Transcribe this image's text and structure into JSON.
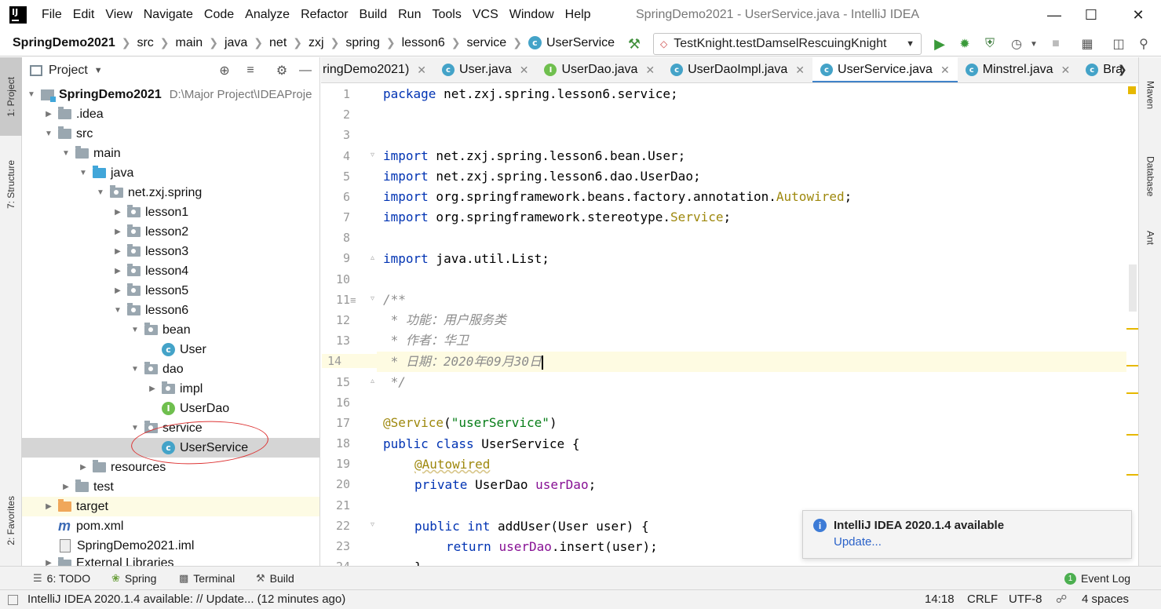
{
  "app": {
    "window_title": "SpringDemo2021 - UserService.java - IntelliJ IDEA",
    "logo_letters": "IJ"
  },
  "menu": [
    "File",
    "Edit",
    "View",
    "Navigate",
    "Code",
    "Analyze",
    "Refactor",
    "Build",
    "Run",
    "Tools",
    "VCS",
    "Window",
    "Help"
  ],
  "breadcrumb": [
    "SpringDemo2021",
    "src",
    "main",
    "java",
    "net",
    "zxj",
    "spring",
    "lesson6",
    "service",
    "UserService"
  ],
  "run_config": "TestKnight.testDamselRescuingKnight",
  "left_tabs": {
    "project": "1: Project",
    "structure": "7: Structure",
    "favorites": "2: Favorites"
  },
  "right_tabs": {
    "maven": "Maven",
    "database": "Database",
    "ant": "Ant"
  },
  "project_panel": {
    "title": "Project",
    "tree": [
      {
        "label": "SpringDemo2021",
        "hint": "D:\\Major Project\\IDEAProje"
      },
      {
        "label": ".idea"
      },
      {
        "label": "src"
      },
      {
        "label": "main"
      },
      {
        "label": "java"
      },
      {
        "label": "net.zxj.spring"
      },
      {
        "label": "lesson1"
      },
      {
        "label": "lesson2"
      },
      {
        "label": "lesson3"
      },
      {
        "label": "lesson4"
      },
      {
        "label": "lesson5"
      },
      {
        "label": "lesson6"
      },
      {
        "label": "bean"
      },
      {
        "label": "User"
      },
      {
        "label": "dao"
      },
      {
        "label": "impl"
      },
      {
        "label": "UserDao"
      },
      {
        "label": "service"
      },
      {
        "label": "UserService"
      },
      {
        "label": "resources"
      },
      {
        "label": "test"
      },
      {
        "label": "target"
      },
      {
        "label": "pom.xml"
      },
      {
        "label": "SpringDemo2021.iml"
      },
      {
        "label": "External Libraries"
      }
    ]
  },
  "editor_tabs": [
    "ringDemo2021)",
    "User.java",
    "UserDao.java",
    "UserDaoImpl.java",
    "UserService.java",
    "Minstrel.java",
    "Bra"
  ],
  "active_tab": "UserService.java",
  "code": {
    "line_numbers": [
      "1",
      "2",
      "3",
      "4",
      "5",
      "6",
      "7",
      "8",
      "9",
      "10",
      "11",
      "12",
      "13",
      "14",
      "15",
      "16",
      "17",
      "18",
      "19",
      "20",
      "21",
      "22",
      "23",
      "24"
    ],
    "l1_kw": "package",
    "l1_rest": " net.zxj.spring.lesson6.service;",
    "l4_kw": "import",
    "l4_rest": " net.zxj.spring.lesson6.bean.User;",
    "l5_kw": "import",
    "l5_rest": " net.zxj.spring.lesson6.dao.UserDao;",
    "l6_kw": "import",
    "l6_rest": " org.springframework.beans.factory.annotation.",
    "l6_ann": "Autowired",
    "l6_end": ";",
    "l7_kw": "import",
    "l7_rest": " org.springframework.stereotype.",
    "l7_ann": "Service",
    "l7_end": ";",
    "l9_kw": "import",
    "l9_rest": " java.util.List;",
    "l11": "/**",
    "l12": " * 功能：用户服务类",
    "l13": " * 作者：华卫",
    "l14": " * 日期：2020年09月30日",
    "l15": " */",
    "l17_ann": "@Service",
    "l17_p1": "(",
    "l17_str": "\"userService\"",
    "l17_p2": ")",
    "l18_kw": "public class",
    "l18_rest": " UserService {",
    "l19_ann": "@Autowired",
    "l20_kw": "private",
    "l20_type": " UserDao ",
    "l20_fld": "userDao",
    "l20_end": ";",
    "l22_kw": "public int",
    "l22_rest": " addUser(User user) {",
    "l23_kw": "return",
    "l23_sp": " ",
    "l23_fld": "userDao",
    "l23_rest": ".insert(user);",
    "l24": "}"
  },
  "notification": {
    "title": "IntelliJ IDEA 2020.1.4 available",
    "link": "Update..."
  },
  "tool_windows": {
    "todo": "6: TODO",
    "spring": "Spring",
    "terminal": "Terminal",
    "build": "Build",
    "event_log": "Event Log"
  },
  "status": {
    "message": "IntelliJ IDEA 2020.1.4 available: // Update... (12 minutes ago)",
    "position": "14:18",
    "line_sep": "CRLF",
    "encoding": "UTF-8",
    "indent": "4 spaces"
  },
  "colors": {
    "keyword": "#0033b3",
    "annotation": "#9e880d",
    "string": "#067d17",
    "field": "#871094",
    "comment": "#8c8c8c",
    "accent": "#4083c9"
  }
}
